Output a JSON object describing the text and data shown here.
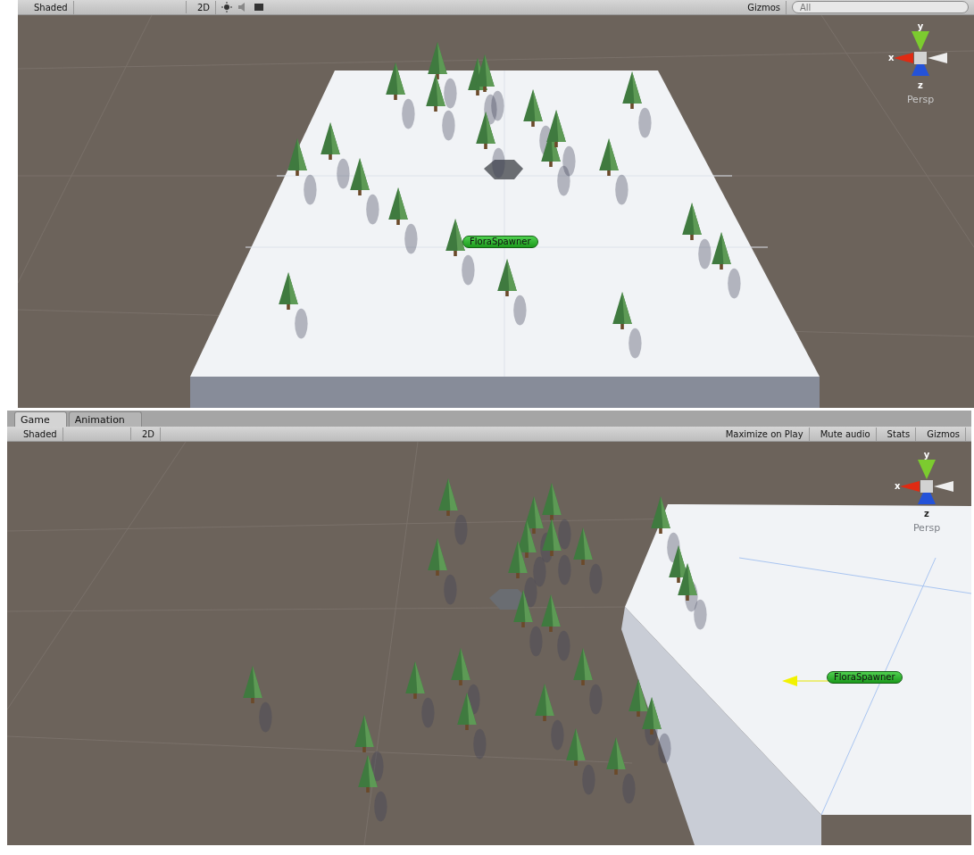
{
  "scene_toolbar": {
    "shading": "Shaded",
    "mode_2d": "2D",
    "gizmos": "Gizmos",
    "search": {
      "placeholder": "All"
    }
  },
  "scene_view": {
    "object_label": "FloraSpawner",
    "gizmo": {
      "x": "x",
      "y": "y",
      "z": "z",
      "projection": "Persp"
    }
  },
  "tabs": [
    {
      "label": "Game",
      "selected": true
    },
    {
      "label": "Animation",
      "selected": false
    }
  ],
  "game_toolbar": {
    "shading": "Shaded",
    "mode_2d": "2D",
    "buttons": [
      "Maximize on Play",
      "Mute audio",
      "Stats",
      "Gizmos"
    ]
  },
  "game_view": {
    "object_label": "FloraSpawner",
    "gizmo": {
      "x": "x",
      "y": "y",
      "z": "z",
      "projection": "Persp"
    }
  }
}
